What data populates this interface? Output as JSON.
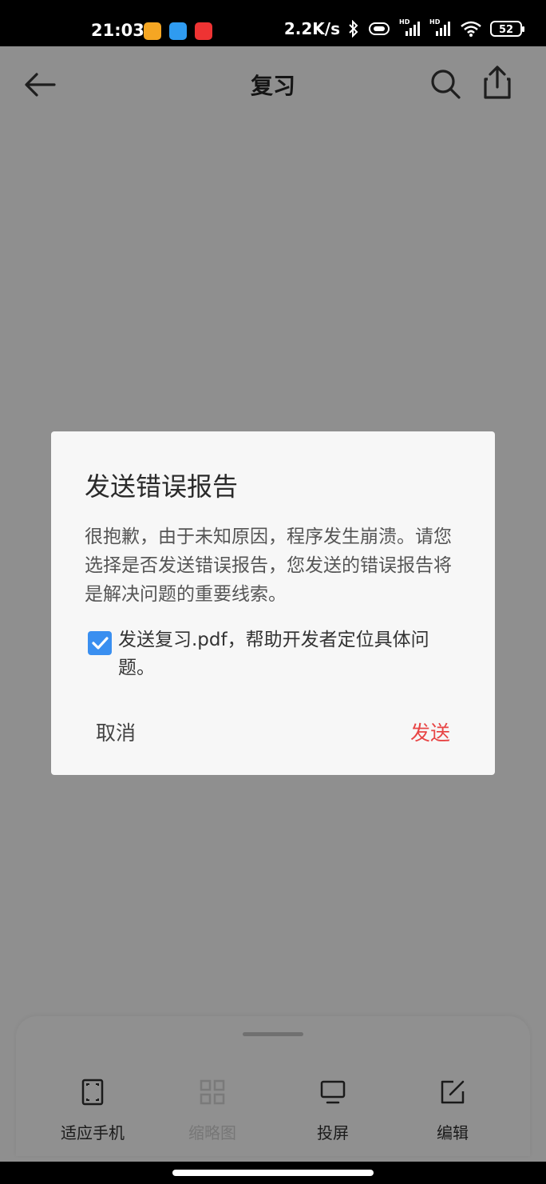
{
  "status_bar": {
    "time": "21:03",
    "net_speed": "2.2K/s",
    "battery": "52",
    "net_badge_1": "HD",
    "net_badge_2": "HD"
  },
  "toolbar": {
    "title": "复习"
  },
  "dialog": {
    "title": "发送错误报告",
    "message": "很抱歉，由于未知原因，程序发生崩溃。请您选择是否发送错误报告，您发送的错误报告将是解决问题的重要线索。",
    "checkbox_label": "发送复习.pdf，帮助开发者定位具体问题。",
    "checkbox_checked": true,
    "cancel_label": "取消",
    "send_label": "发送",
    "send_color": "#e84545",
    "checkbox_color": "#3a8ff0"
  },
  "bottom_tools": [
    {
      "label": "适应手机",
      "icon": "fit-screen-icon",
      "enabled": true
    },
    {
      "label": "缩略图",
      "icon": "thumbnail-grid-icon",
      "enabled": false
    },
    {
      "label": "投屏",
      "icon": "cast-screen-icon",
      "enabled": true
    },
    {
      "label": "编辑",
      "icon": "edit-icon",
      "enabled": true
    }
  ]
}
